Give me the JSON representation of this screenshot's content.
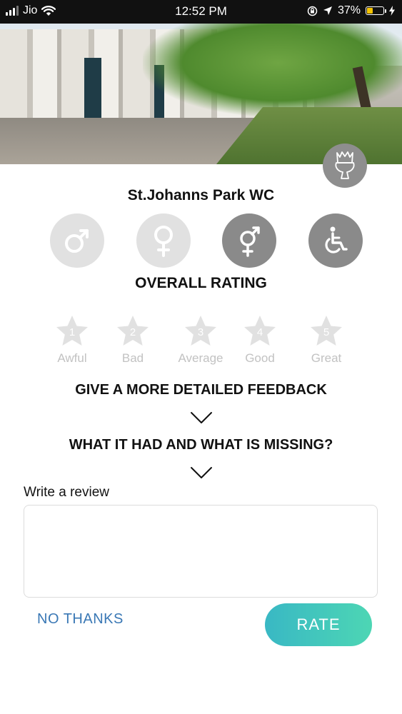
{
  "status_bar": {
    "carrier": "Jio",
    "time": "12:52 PM",
    "battery": "37%",
    "battery_level": 0.37,
    "icons": [
      "signal-icon",
      "wifi-icon",
      "orientation-lock-icon",
      "location-arrow-icon",
      "battery-icon",
      "charging-bolt-icon"
    ]
  },
  "place": {
    "name": "St.Johanns Park WC",
    "badge_icon": "toilet-icon"
  },
  "gender_options": [
    {
      "icon": "male-icon",
      "selected": false
    },
    {
      "icon": "female-icon",
      "selected": false
    },
    {
      "icon": "unisex-icon",
      "selected": true
    },
    {
      "icon": "wheelchair-icon",
      "selected": true
    }
  ],
  "rating": {
    "title": "OVERALL RATING",
    "stars": [
      {
        "number": "1",
        "label": "Awful"
      },
      {
        "number": "2",
        "label": "Bad"
      },
      {
        "number": "3",
        "label": "Average"
      },
      {
        "number": "4",
        "label": "Good"
      },
      {
        "number": "5",
        "label": "Great"
      }
    ],
    "selected": 0
  },
  "sections": {
    "detailed_feedback": "GIVE A MORE DETAILED FEEDBACK",
    "had_missing": "WHAT IT HAD AND WHAT IS MISSING?"
  },
  "review": {
    "label": "Write a review",
    "value": ""
  },
  "actions": {
    "no_thanks": "NO THANKS",
    "rate": "RATE"
  },
  "colors": {
    "accent_gradient_start": "#39b8c4",
    "accent_gradient_end": "#4dd6b4",
    "link": "#3a78b5",
    "selected_circle": "#8a8a8a",
    "unselected_circle": "#e1e1e1",
    "star_inactive": "#e1e1e1"
  }
}
